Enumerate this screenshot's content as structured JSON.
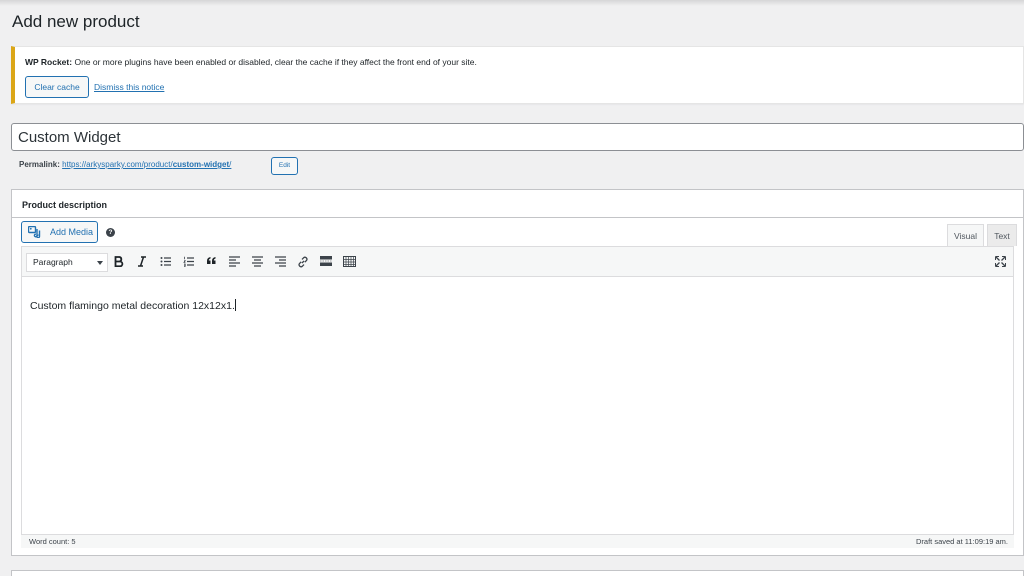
{
  "page": {
    "title": "Add new product"
  },
  "notice": {
    "plugin": "WP Rocket:",
    "message": "One or more plugins have been enabled or disabled, clear the cache if they affect the front end of your site.",
    "clear_cache_label": "Clear cache",
    "dismiss_label": "Dismiss this notice",
    "border_color": "#dba617"
  },
  "product": {
    "title_value": "Custom Widget",
    "permalink_label": "Permalink:",
    "permalink_base": "https://arkysparky.com/product/",
    "permalink_slug": "custom-widget",
    "permalink_trailing": "/",
    "edit_label": "Edit"
  },
  "description": {
    "box_title": "Product description",
    "add_media_label": "Add Media",
    "help_glyph": "?",
    "tabs": [
      {
        "label": "Visual",
        "active": true
      },
      {
        "label": "Text",
        "active": false
      }
    ],
    "format_select_value": "Paragraph",
    "toolbar_icons": [
      "bold-icon",
      "italic-icon",
      "bulleted-list-icon",
      "numbered-list-icon",
      "blockquote-icon",
      "align-left-icon",
      "align-center-icon",
      "align-right-icon",
      "link-icon",
      "read-more-icon",
      "toolbar-toggle-icon",
      "fullscreen-icon"
    ],
    "content": "Custom flamingo metal decoration 12x12x1.",
    "word_count": "Word count: 5",
    "draft_saved": "Draft saved at 11:09:19 am."
  },
  "colors": {
    "link": "#2271b1",
    "background": "#f0f0f1"
  }
}
